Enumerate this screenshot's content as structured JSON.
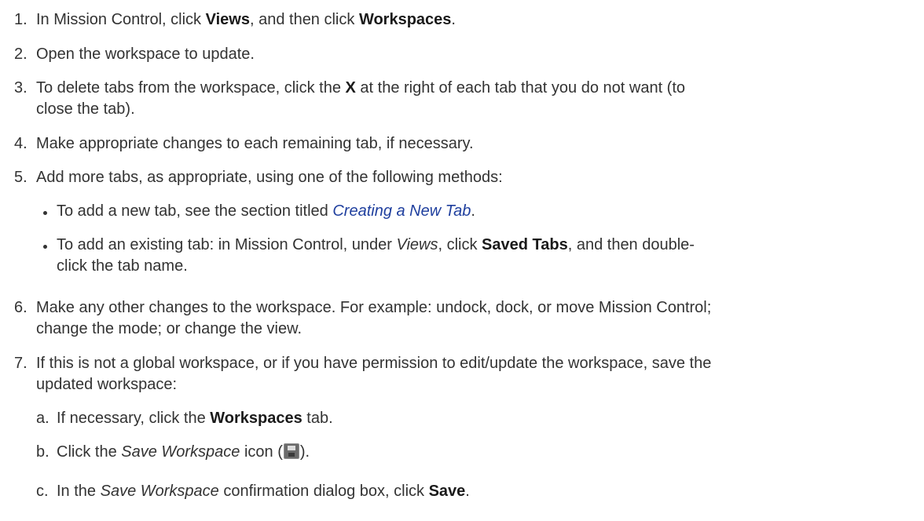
{
  "colors": {
    "text": "#333333",
    "link": "#1f3f9e",
    "icon": "#6b6b6b"
  },
  "steps": [
    {
      "number": "1.",
      "lines": [
        [
          {
            "t": "In Mission Control, click "
          },
          {
            "t": "Views",
            "s": "b"
          },
          {
            "t": ", and then click "
          },
          {
            "t": "Workspaces",
            "s": "b"
          },
          {
            "t": "."
          }
        ]
      ]
    },
    {
      "number": "2.",
      "lines": [
        [
          {
            "t": "Open the workspace to update."
          }
        ]
      ]
    },
    {
      "number": "3.",
      "lines": [
        [
          {
            "t": "To delete tabs from the workspace, click the "
          },
          {
            "t": "X",
            "s": "b"
          },
          {
            "t": " at the right of each tab that you do not want (to"
          }
        ],
        [
          {
            "t": "close the tab)."
          }
        ]
      ]
    },
    {
      "number": "4.",
      "lines": [
        [
          {
            "t": "Make appropriate changes to each remaining tab, if necessary."
          }
        ]
      ]
    },
    {
      "number": "5.",
      "lines": [
        [
          {
            "t": "Add more tabs, as appropriate, using one of the following methods:"
          }
        ]
      ],
      "bullets": [
        {
          "lines": [
            [
              {
                "t": "To add a new tab, see the section titled "
              },
              {
                "t": "Creating a New Tab",
                "s": "link"
              },
              {
                "t": "."
              }
            ]
          ]
        },
        {
          "lines": [
            [
              {
                "t": "To add an existing tab: in Mission Control, under "
              },
              {
                "t": "Views",
                "s": "i"
              },
              {
                "t": ", click "
              },
              {
                "t": "Saved Tabs",
                "s": "b"
              },
              {
                "t": ", and then double-"
              }
            ],
            [
              {
                "t": "click the tab name."
              }
            ]
          ]
        }
      ]
    },
    {
      "number": "6.",
      "lines": [
        [
          {
            "t": "Make any other changes to the workspace. For example: undock, dock, or move Mission Control;"
          }
        ],
        [
          {
            "t": "change the mode; or change the view."
          }
        ]
      ]
    },
    {
      "number": "7.",
      "lines": [
        [
          {
            "t": "If this is not a global workspace, or if you have permission to edit/update the workspace, save the"
          }
        ],
        [
          {
            "t": "updated workspace:"
          }
        ]
      ],
      "substeps": [
        {
          "letter": "a.",
          "lines": [
            [
              {
                "t": "If necessary, click the "
              },
              {
                "t": "Workspaces",
                "s": "b"
              },
              {
                "t": " tab."
              }
            ]
          ]
        },
        {
          "letter": "b.",
          "lines": [
            [
              {
                "t": "Click the "
              },
              {
                "t": "Save Workspace",
                "s": "i"
              },
              {
                "t": " icon ("
              },
              {
                "icon": "save-workspace-icon"
              },
              {
                "t": ")."
              }
            ]
          ]
        },
        {
          "letter": "c.",
          "lines": [
            [
              {
                "t": "In the "
              },
              {
                "t": "Save Workspace",
                "s": "i"
              },
              {
                "t": " confirmation dialog box, click "
              },
              {
                "t": "Save",
                "s": "b"
              },
              {
                "t": "."
              }
            ]
          ]
        }
      ]
    }
  ]
}
